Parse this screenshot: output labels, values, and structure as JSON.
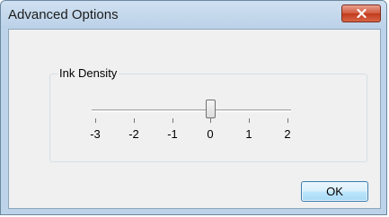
{
  "window": {
    "title": "Advanced Options"
  },
  "group": {
    "label": "Ink Density"
  },
  "slider": {
    "ticks": [
      "-3",
      "-2",
      "-1",
      "0",
      "1",
      "2"
    ],
    "value": "0",
    "value_index": 3
  },
  "buttons": {
    "ok_label": "OK",
    "close_icon": "close-x-icon"
  },
  "colors": {
    "close_button": "#c7442a",
    "ok_border": "#3c7fb1",
    "window_frame": "#bcd3ea"
  }
}
